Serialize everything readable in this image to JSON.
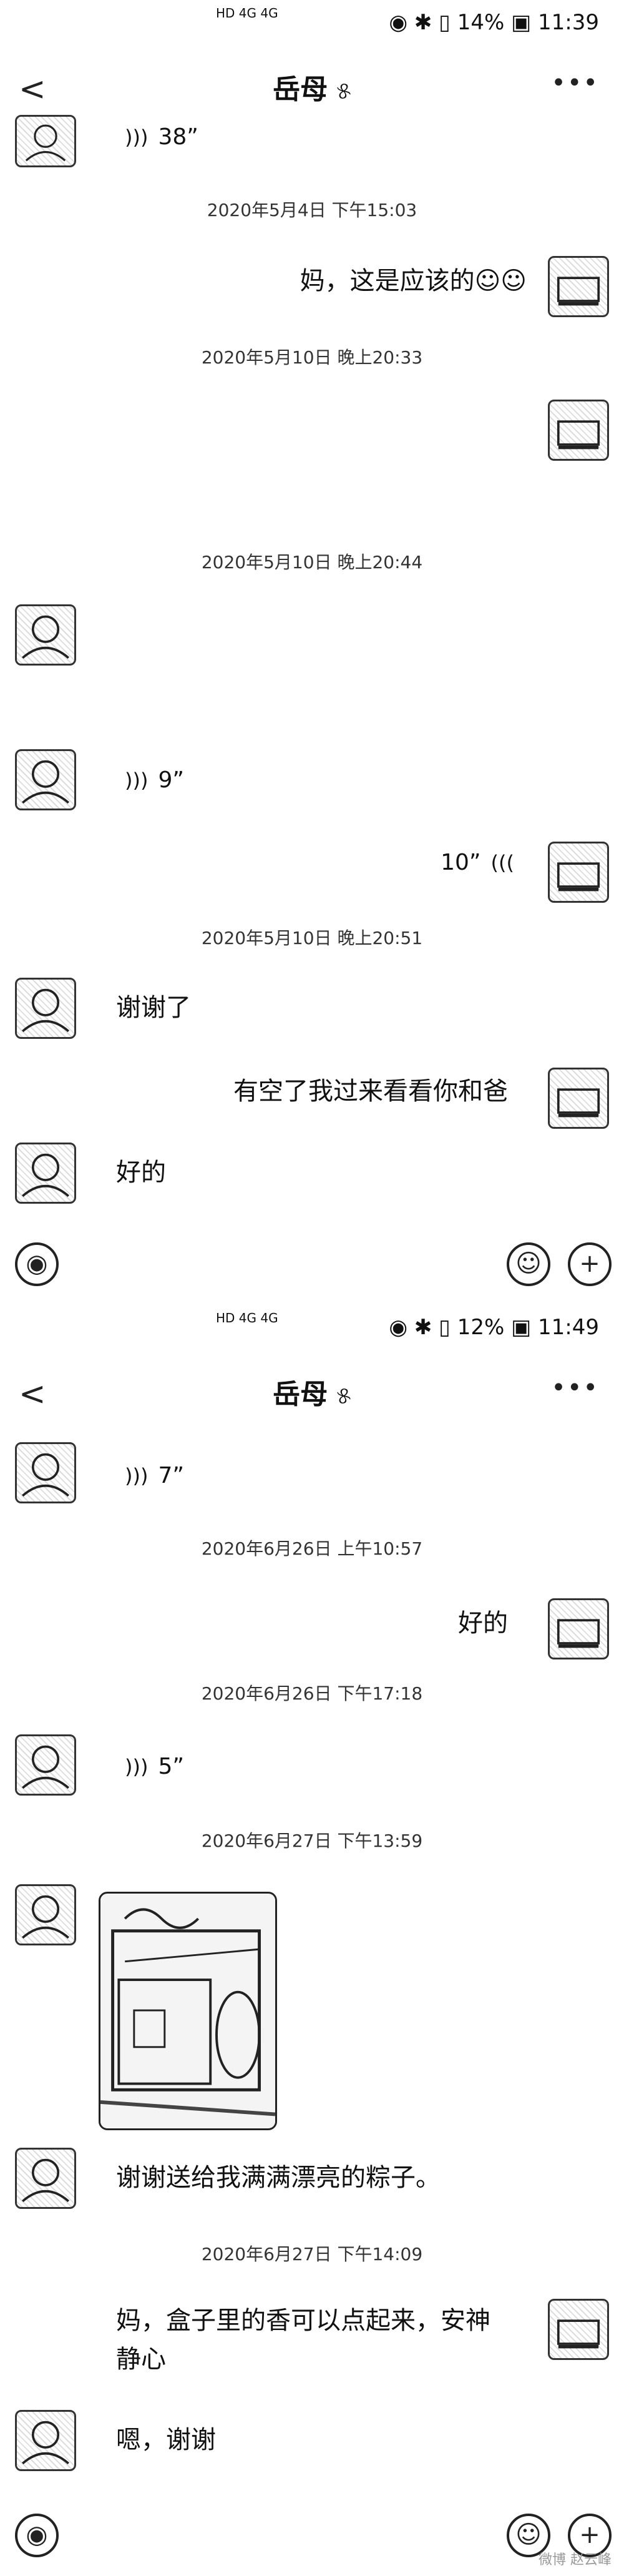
{
  "screen1": {
    "status": {
      "left": "HD 4G 4G",
      "right": "◉ ✱ ▯ 14% ▣ 11:39"
    },
    "nav": {
      "back": "<",
      "title": "岳母",
      "ear": "୫",
      "more": "•••"
    },
    "voice_top": "38”",
    "timestamps": [
      "2020年5月4日 下午15:03",
      "2020年5月10日 晚上20:33",
      "2020年5月10日 晚上20:44",
      "2020年5月10日 晚上20:51"
    ],
    "messages": {
      "m1": "妈，这是应该的",
      "v9": "9”",
      "v10": "10”",
      "m_thanks": "谢谢了",
      "m_visit": "有空了我过来看看你和爸",
      "m_ok": "好的"
    },
    "emoji": "☺☺"
  },
  "screen2": {
    "status": {
      "left": "HD 4G 4G",
      "right": "◉ ✱ ▯ 12% ▣ 11:49"
    },
    "nav": {
      "back": "<",
      "title": "岳母",
      "ear": "୫",
      "more": "•••"
    },
    "voice_top": "7”",
    "timestamps": [
      "2020年6月26日 上午10:57",
      "2020年6月26日 下午17:18",
      "2020年6月27日 下午13:59",
      "2020年6月27日 下午14:09"
    ],
    "messages": {
      "m_ok": "好的",
      "v5": "5”",
      "m_zongzi": "谢谢送给我满满漂亮的粽子。",
      "m_incense_1": "妈，盒子里的香可以点起来，安神",
      "m_incense_2": "静心",
      "m_thanks": "嗯，谢谢"
    }
  },
  "inputbar": {
    "voice_icon": "◉",
    "emoji_icon": "☺",
    "plus_icon": "+"
  },
  "watermark": "微博 赵云峰",
  "colors": {
    "text": "#111111",
    "timestamp": "#333333",
    "background": "#ffffff"
  }
}
